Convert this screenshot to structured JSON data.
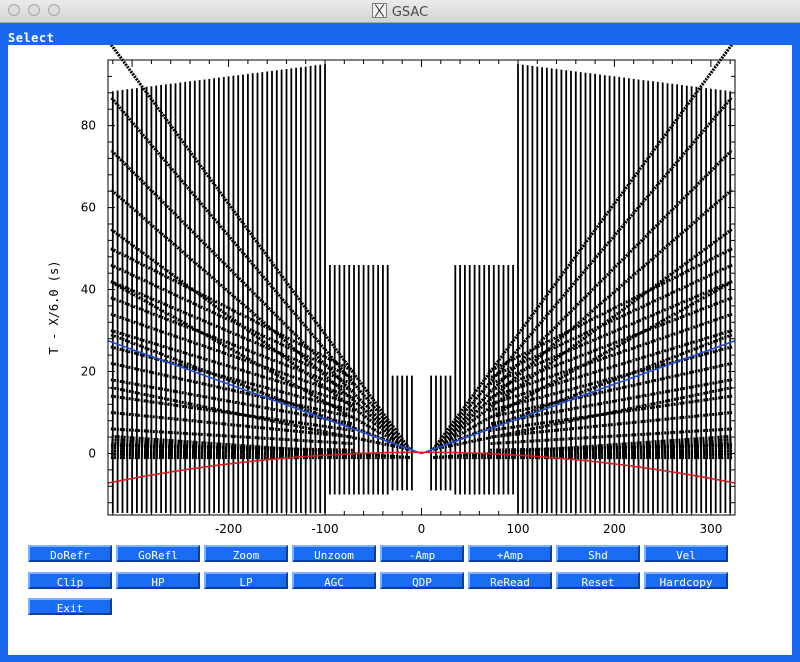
{
  "window": {
    "title": "GSAC"
  },
  "panel": {
    "label": "Select"
  },
  "plot": {
    "ylabel": "T - X/6.0 (s)",
    "xticks": [
      "-200",
      "-100",
      "0",
      "100",
      "200",
      "300"
    ],
    "yticks": [
      "0",
      "20",
      "40",
      "60",
      "80"
    ],
    "xlim": [
      -325,
      325
    ],
    "ylim": [
      -15,
      96
    ],
    "colors": {
      "traces": "#000000",
      "blue_curve": "#1f4fd8",
      "red_curve": "#d42020"
    }
  },
  "buttons": {
    "row1": [
      "DoRefr",
      "GoRefl",
      "Zoom",
      "Unzoom",
      "-Amp",
      "+Amp",
      "Shd",
      "Vel"
    ],
    "row2": [
      "Clip",
      "HP",
      "LP",
      "AGC",
      "QDP",
      "ReRead",
      "Reset",
      "Hardcopy"
    ],
    "row3": [
      "Exit"
    ]
  }
}
